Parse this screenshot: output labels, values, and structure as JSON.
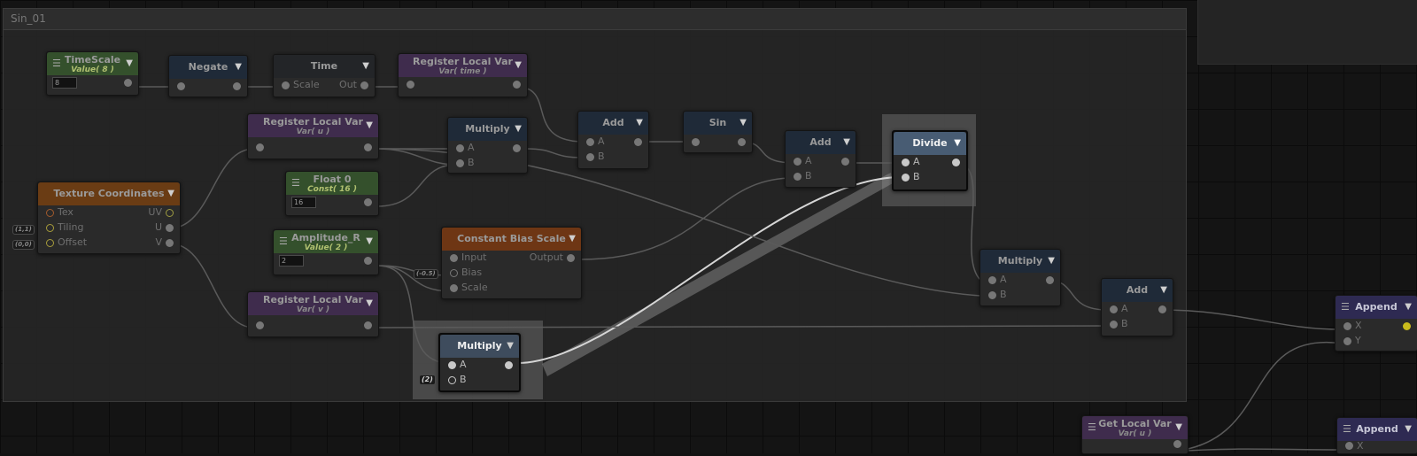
{
  "graph": {
    "group_title": "Sin_01",
    "nodes": {
      "timescale": {
        "title": "TimeScale",
        "subtitle": "Value( 8 )",
        "value": "8"
      },
      "negate": {
        "title": "Negate"
      },
      "time": {
        "title": "Time",
        "input": "Scale",
        "output": "Out"
      },
      "reg_time": {
        "title": "Register Local Var",
        "subtitle": "Var( time )"
      },
      "reg_u": {
        "title": "Register Local Var",
        "subtitle": "Var( u )"
      },
      "multiply1": {
        "title": "Multiply",
        "a": "A",
        "b": "B"
      },
      "add1": {
        "title": "Add",
        "a": "A",
        "b": "B"
      },
      "sin": {
        "title": "Sin"
      },
      "add2": {
        "title": "Add",
        "a": "A",
        "b": "B"
      },
      "divide": {
        "title": "Divide",
        "a": "A",
        "b": "B"
      },
      "texcoord": {
        "title": "Texture Coordinates",
        "in1": "Tex",
        "in2": "Tiling",
        "in3": "Offset",
        "out1": "UV",
        "out2": "U",
        "out3": "V",
        "tiling_badge": "(1,1)",
        "offset_badge": "(0,0)"
      },
      "float0": {
        "title": "Float 0",
        "subtitle": "Const( 16 )",
        "value": "16"
      },
      "amplitude": {
        "title": "Amplitude_R",
        "subtitle": "Value( 2 )",
        "value": "2"
      },
      "cbs": {
        "title": "Constant Bias Scale",
        "in1": "Input",
        "in2": "Bias",
        "in3": "Scale",
        "out": "Output",
        "bias_badge": "(-0.5)"
      },
      "reg_v": {
        "title": "Register Local Var",
        "subtitle": "Var( v )"
      },
      "multiply2": {
        "title": "Multiply",
        "a": "A",
        "b": "B"
      },
      "multiply3": {
        "title": "Multiply",
        "a": "A",
        "b": "B",
        "b_badge": "(2)"
      },
      "add3": {
        "title": "Add",
        "a": "A",
        "b": "B"
      },
      "append1": {
        "title": "Append",
        "x": "X",
        "y": "Y"
      },
      "get_u": {
        "title": "Get Local Var",
        "subtitle": "Var( u )"
      },
      "append2": {
        "title": "Append",
        "x": "X"
      }
    }
  },
  "colors": {
    "value_header": "#34502c",
    "register_var_header": "#3f2c4d",
    "function_header": "#6a3c14",
    "math_header": "#1f2a38",
    "selected_header": "#485c73",
    "append_header": "#2e2a52"
  },
  "icons": {
    "menu": "hamburger-icon",
    "dropdown": "triangle-down-icon",
    "port": "circle-port"
  }
}
